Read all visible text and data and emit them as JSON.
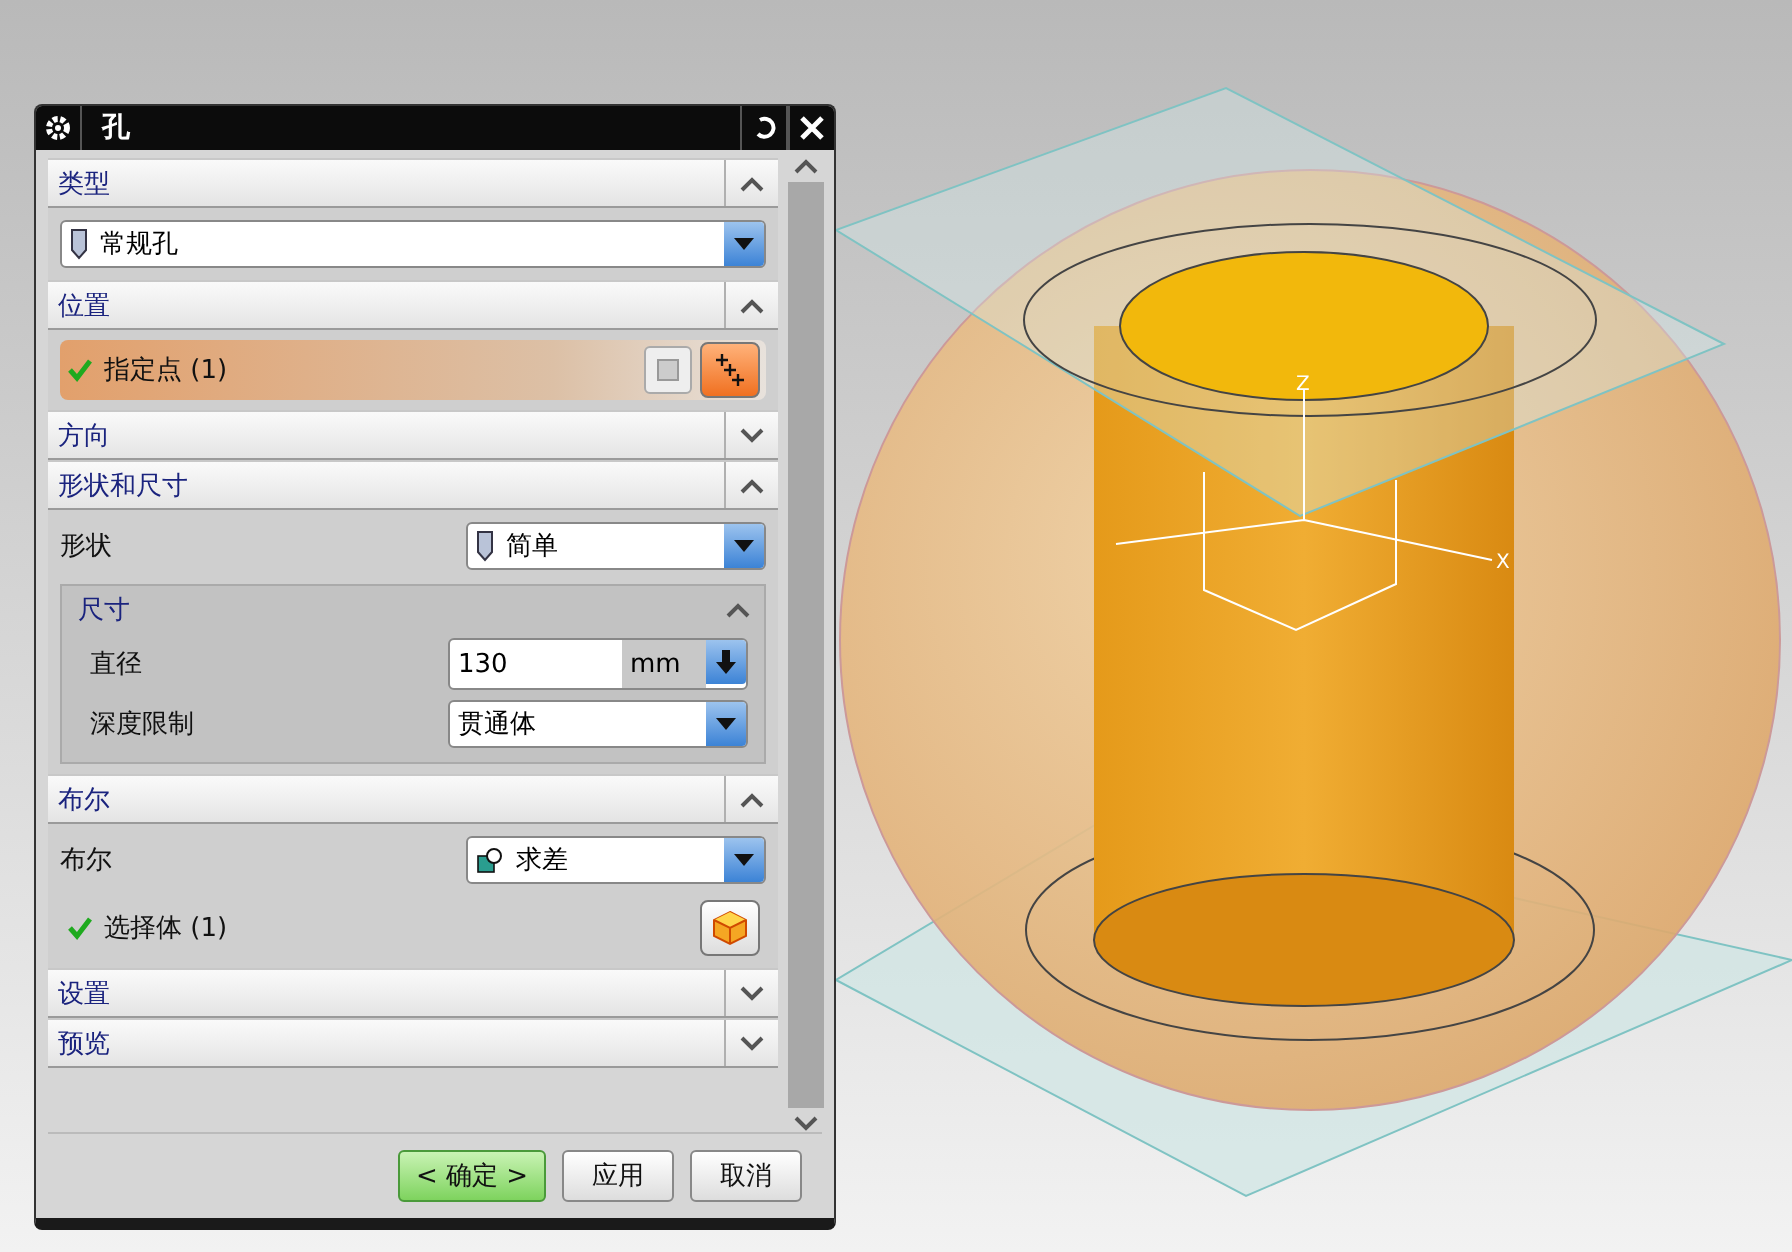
{
  "dialog": {
    "title": "孔",
    "sections": [
      {
        "title": "类型",
        "expanded": true,
        "rows": [
          {
            "kind": "type_dropdown",
            "value": "常规孔"
          }
        ]
      },
      {
        "title": "位置",
        "expanded": true,
        "rows": [
          {
            "kind": "point_selection",
            "label": "指定点 (1)",
            "done": true,
            "active": true
          }
        ]
      },
      {
        "title": "方向",
        "expanded": false
      },
      {
        "title": "形状和尺寸",
        "expanded": true,
        "rows": [
          {
            "kind": "shape_dropdown",
            "label": "形状",
            "value": "简单"
          },
          {
            "kind": "group",
            "title": "尺寸",
            "expanded": true,
            "rows": [
              {
                "kind": "number",
                "label": "直径",
                "value": "130",
                "unit": "mm"
              },
              {
                "kind": "plain_dropdown",
                "label": "深度限制",
                "value": "贯通体"
              }
            ]
          }
        ]
      },
      {
        "title": "布尔",
        "expanded": true,
        "rows": [
          {
            "kind": "boolean_dropdown",
            "label": "布尔",
            "value": "求差"
          },
          {
            "kind": "body_selection",
            "label": "选择体 (1)",
            "done": true,
            "active": false
          }
        ]
      },
      {
        "title": "设置",
        "expanded": false
      },
      {
        "title": "预览",
        "expanded": false
      }
    ],
    "buttons": [
      {
        "label": "< 确定 >",
        "primary": true
      },
      {
        "label": "应用",
        "primary": false
      },
      {
        "label": "取消",
        "primary": false
      }
    ]
  },
  "viewport": {
    "axis_labels": [
      "Z",
      "X"
    ]
  }
}
